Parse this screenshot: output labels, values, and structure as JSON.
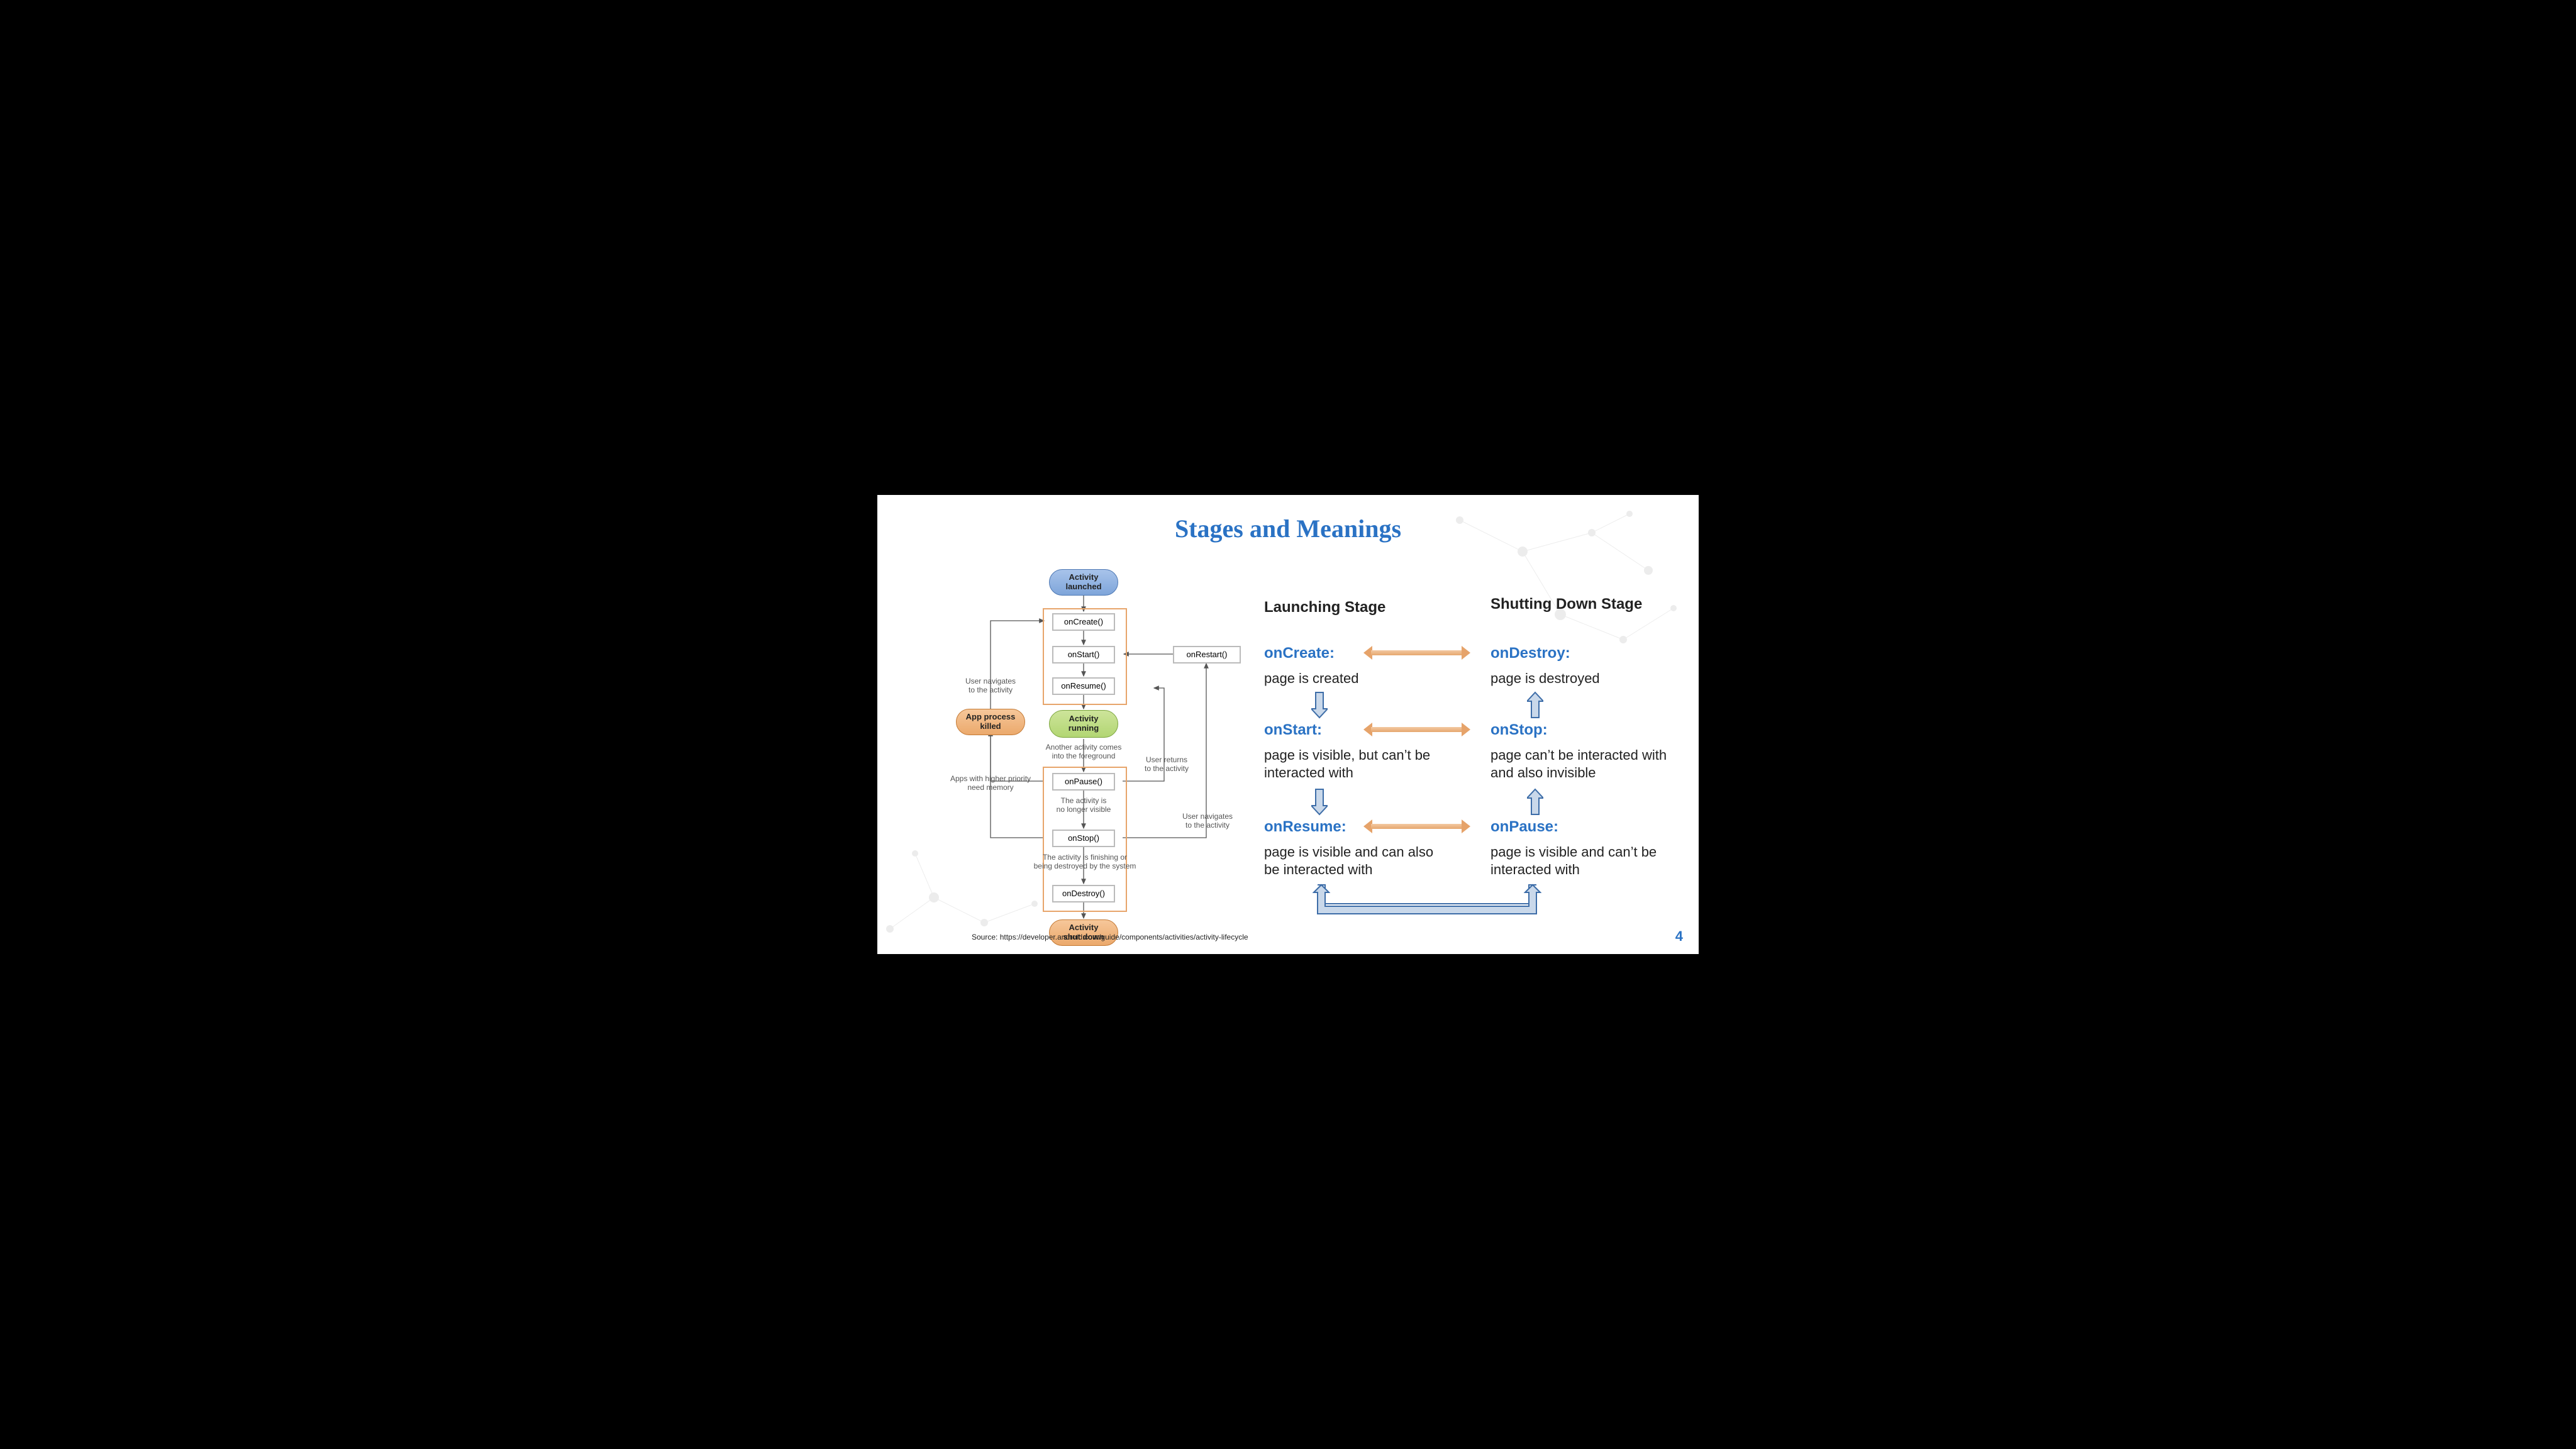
{
  "title": "Stages and Meanings",
  "page_number": "4",
  "source": "Source: https://developer.android.com/guide/components/activities/activity-lifecycle",
  "flow": {
    "activity_launched": "Activity\nlaunched",
    "onCreate": "onCreate()",
    "onStart": "onStart()",
    "onResume": "onResume()",
    "activity_running": "Activity\nrunning",
    "onPause": "onPause()",
    "onStop": "onStop()",
    "onDestroy": "onDestroy()",
    "activity_shutdown": "Activity\nshut down",
    "onRestart": "onRestart()",
    "app_killed": "App process\nkilled",
    "lbl_user_nav_top": "User navigates\nto the activity",
    "lbl_apps_priority": "Apps with higher priority\nneed memory",
    "lbl_another_fg": "Another activity comes\ninto the foreground",
    "lbl_user_returns": "User returns\nto the activity",
    "lbl_no_longer_visible": "The activity is\nno longer visible",
    "lbl_user_nav_bottom": "User navigates\nto the activity",
    "lbl_finishing": "The activity is finishing or\nbeing destroyed by the system"
  },
  "right": {
    "launching_header": "Launching Stage",
    "shutdown_header": "Shutting Down Stage",
    "onCreate_t": "onCreate:",
    "onCreate_d": "page is created",
    "onStart_t": "onStart:",
    "onStart_d": "page is visible, but can’t be interacted with",
    "onResume_t": "onResume:",
    "onResume_d": "page is visible and can also be interacted with",
    "onDestroy_t": "onDestroy:",
    "onDestroy_d": "page is destroyed",
    "onStop_t": "onStop:",
    "onStop_d": "page can’t be interacted with and also invisible",
    "onPause_t": "onPause:",
    "onPause_d": "page is visible and can’t be interacted with"
  }
}
